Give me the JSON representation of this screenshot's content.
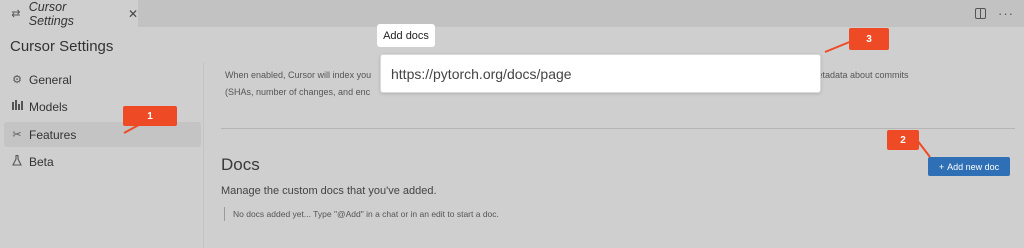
{
  "tab": {
    "label": "Cursor Settings",
    "icon": "settings-sliders-icon"
  },
  "window_actions": {
    "split_icon": "split-editor-icon",
    "more_label": "···"
  },
  "page_title": "Cursor Settings",
  "sidebar": {
    "items": [
      {
        "label": "General",
        "icon": "gear-icon"
      },
      {
        "label": "Models",
        "icon": "bar-chart-icon"
      },
      {
        "label": "Features",
        "icon": "tools-icon"
      },
      {
        "label": "Beta",
        "icon": "flask-icon"
      }
    ]
  },
  "main": {
    "description_line1_left": "When enabled, Cursor will index you",
    "description_line1_right": "ered locally, but metadata about commits",
    "description_line2": "(SHAs, number of changes, and enc",
    "docs_heading": "Docs",
    "docs_subtitle": "Manage the custom docs that you've added.",
    "empty_text": "No docs added yet... Type \"@Add\" in a chat or in an edit to start a doc.",
    "add_button_label": "Add new doc",
    "add_button_icon": "+"
  },
  "popup": {
    "title": "Add docs",
    "input_value": "https://pytorch.org/docs/page"
  },
  "annotations": {
    "badge1": "1",
    "badge2": "2",
    "badge3": "3",
    "color": "#ee4a26"
  },
  "colors": {
    "accent_button": "#2f6fb5",
    "background": "#cfcfcf"
  }
}
